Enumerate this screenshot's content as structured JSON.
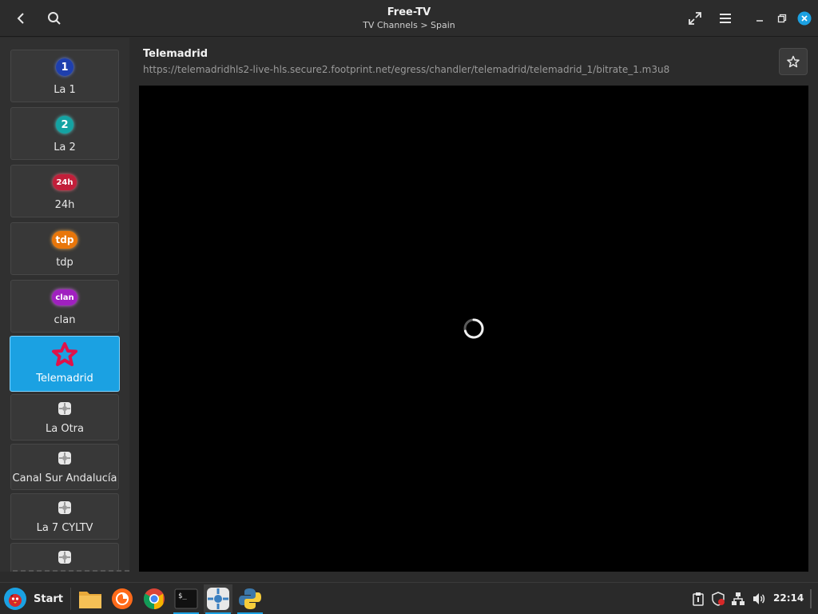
{
  "window": {
    "title": "Free-TV",
    "subtitle": "TV Channels > Spain"
  },
  "header_icons": {
    "back": "chevron-left-icon",
    "search": "search-icon",
    "fullscreen": "expand-icon",
    "menu": "hamburger-menu-icon",
    "minimize": "minimize-icon",
    "maximize": "restore-icon",
    "close": "close-icon"
  },
  "sidebar": {
    "items": [
      {
        "label": "La 1",
        "logo_text": "1",
        "logo_color": "#1e3fae"
      },
      {
        "label": "La 2",
        "logo_text": "2",
        "logo_color": "#14a3a3"
      },
      {
        "label": "24h",
        "logo_text": "24h",
        "logo_color": "#c21f3a"
      },
      {
        "label": "tdp",
        "logo_text": "tdp",
        "logo_color": "#e8760a"
      },
      {
        "label": "clan",
        "logo_text": "clan",
        "logo_color": "#a020c0"
      },
      {
        "label": "Telemadrid",
        "logo": "star-outline-icon",
        "logo_color": "#e0124a",
        "selected": true
      },
      {
        "label": "La Otra",
        "logo": "app-generic-icon"
      },
      {
        "label": "Canal Sur Andalucía",
        "logo": "app-generic-icon"
      },
      {
        "label": "La 7 CYLTV",
        "logo": "app-generic-icon"
      },
      {
        "label": "",
        "logo": "app-generic-icon"
      }
    ]
  },
  "player": {
    "channel_name": "Telemadrid",
    "stream_url": "https://telemadridhls2-live-hls.secure2.footprint.net/egress/chandler/telemadrid/telemadrid_1/bitrate_1.m3u8",
    "state": "loading"
  },
  "taskbar": {
    "start_label": "Start",
    "apps": [
      "file-manager-icon",
      "firefox-icon",
      "chrome-icon",
      "terminal-icon",
      "free-tv-icon",
      "python-icon"
    ],
    "tray": [
      "clipboard-icon",
      "shield-icon",
      "network-icon",
      "volume-icon"
    ],
    "clock": "22:14"
  },
  "colors": {
    "accent": "#1ba1e2",
    "close_button": "#1ba1e2"
  }
}
